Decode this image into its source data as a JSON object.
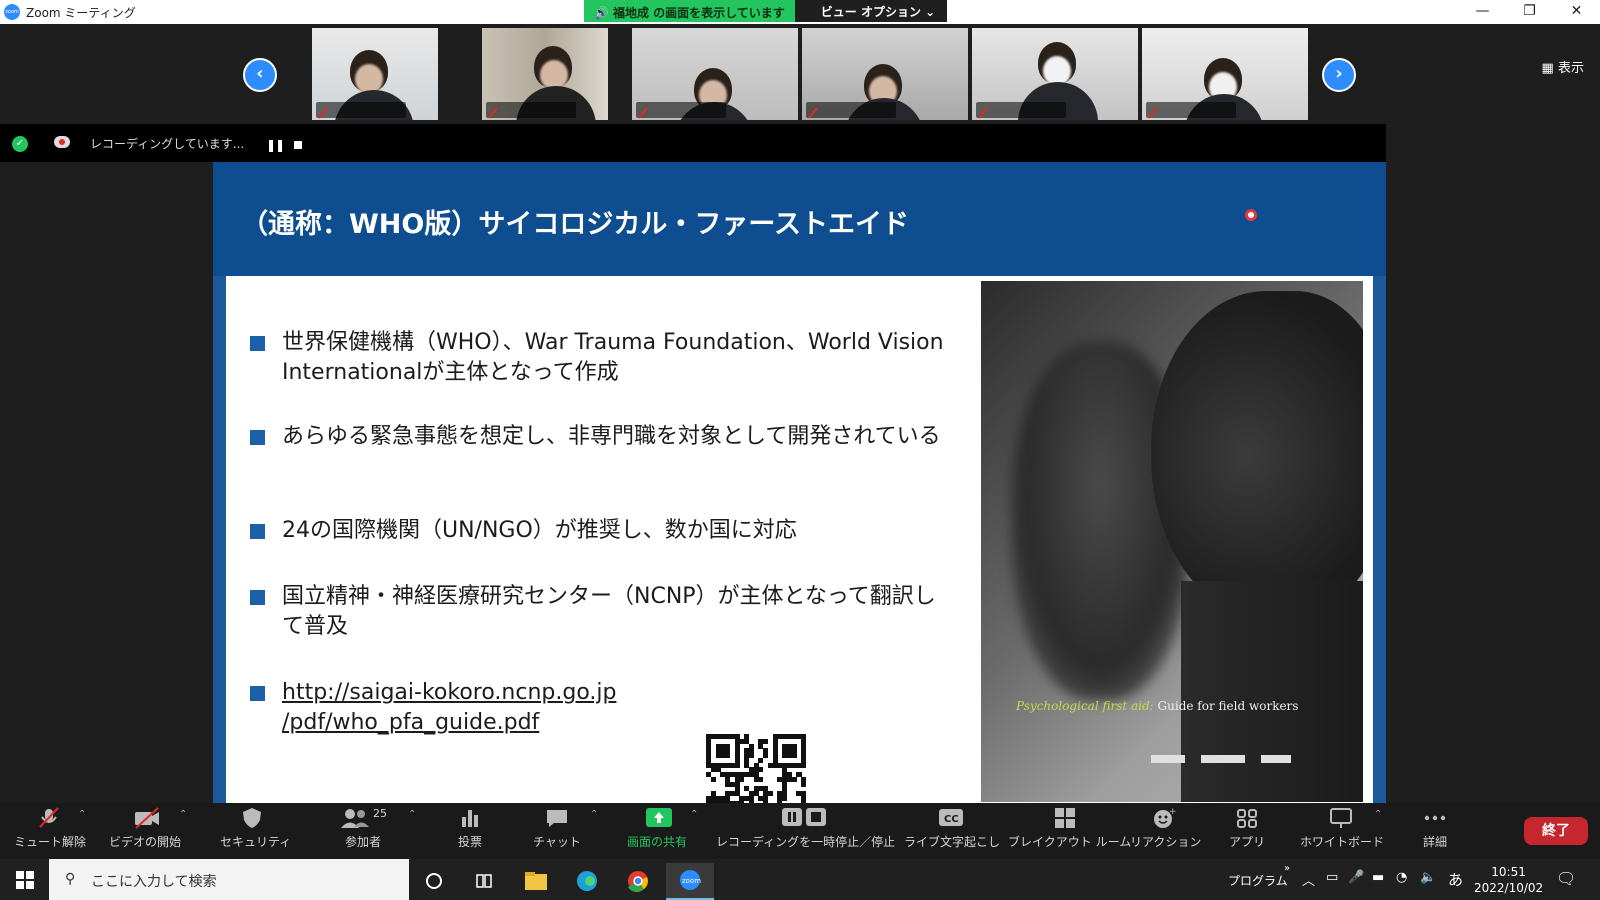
{
  "window": {
    "title": "Zoom ミーティング",
    "app_icon": "zoom",
    "share_banner": "福地成 の画面を表示しています",
    "view_options": "ビュー オプション ⌄",
    "controls": [
      "—",
      "❐",
      "✕"
    ]
  },
  "gallery": {
    "prev_icon": "‹",
    "next_icon": "›",
    "view_label": "表示",
    "participant_count_visible": 6
  },
  "recording": {
    "status": "レコーディングしています...",
    "pause_icon": "❚❚"
  },
  "slide": {
    "title": "（通称：WHO版）サイコロジカル・ファーストエイド",
    "bullets": [
      "世界保健機構（WHO）、War Trauma Foundation、World Vision Internationalが主体となって作成",
      "あらゆる緊急事態を想定し、非専門職を対象として開発されている",
      "24の国際機関（UN/NGO）が推奨し、数か国に対応",
      "国立精神・神経医療研究センター（NCNP）が主体となって翻訳して普及"
    ],
    "link_line1": "http://saigai-kokoro.ncnp.go.jp",
    "link_line2": "/pdf/who_pfa_guide.pdf",
    "photo_caption_italic": "Psychological first aid:",
    "photo_caption_plain": " Guide for field workers"
  },
  "toolbar": {
    "items": [
      {
        "label": "ミュート解除",
        "icon": "mic-muted-icon"
      },
      {
        "label": "ビデオの開始",
        "icon": "video-off-icon"
      },
      {
        "label": "セキュリティ",
        "icon": "shield-icon"
      },
      {
        "label": "参加者",
        "icon": "participants-icon",
        "count": "25"
      },
      {
        "label": "投票",
        "icon": "poll-icon"
      },
      {
        "label": "チャット",
        "icon": "chat-icon"
      },
      {
        "label": "画面の共有",
        "icon": "share-screen-icon"
      },
      {
        "label": "レコーディングを一時停止／停止",
        "icon": "record-pause-stop-icon"
      },
      {
        "label": "ライブ文字起こし",
        "icon": "cc-icon"
      },
      {
        "label": "ブレイクアウト ルーム",
        "icon": "breakout-icon"
      },
      {
        "label": "リアクション",
        "icon": "reaction-icon"
      },
      {
        "label": "アプリ",
        "icon": "apps-icon"
      },
      {
        "label": "ホワイトボード",
        "icon": "whiteboard-icon"
      },
      {
        "label": "詳細",
        "icon": "more-icon"
      }
    ],
    "end_label": "終了",
    "accent_green": "#23c55e",
    "end_red": "#c6262e"
  },
  "taskbar": {
    "search_placeholder": "ここに入力して検索",
    "program_label": "プログラム",
    "ime": "あ",
    "time": "10:51",
    "date": "2022/10/02"
  }
}
